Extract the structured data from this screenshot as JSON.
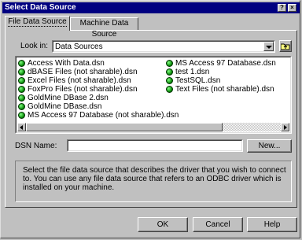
{
  "window": {
    "title": "Select Data Source",
    "help_btn": "?",
    "close_btn": "×"
  },
  "tabs": [
    {
      "label": "File Data Source"
    },
    {
      "label": "Machine Data Source"
    }
  ],
  "look_in": {
    "label": "Look in:",
    "value": "Data Sources"
  },
  "files_col1": [
    "Access With Data.dsn",
    "dBASE Files (not sharable).dsn",
    "Excel Files (not sharable).dsn",
    "FoxPro Files (not sharable).dsn",
    "GoldMine DBase 2.dsn",
    "GoldMine DBase.dsn",
    "MS Access 97 Database (not sharable).dsn"
  ],
  "files_col2": [
    "MS Access 97 Database.dsn",
    "test 1.dsn",
    "TestSQL.dsn",
    "Text Files (not sharable).dsn"
  ],
  "dsn": {
    "label": "DSN Name:",
    "value": "",
    "new_button": "New..."
  },
  "description": "Select the file data source that describes the driver that you wish to connect to.  You can use any file data source that refers to an ODBC driver which is installed on your machine.",
  "footer": {
    "ok": "OK",
    "cancel": "Cancel",
    "help": "Help"
  }
}
